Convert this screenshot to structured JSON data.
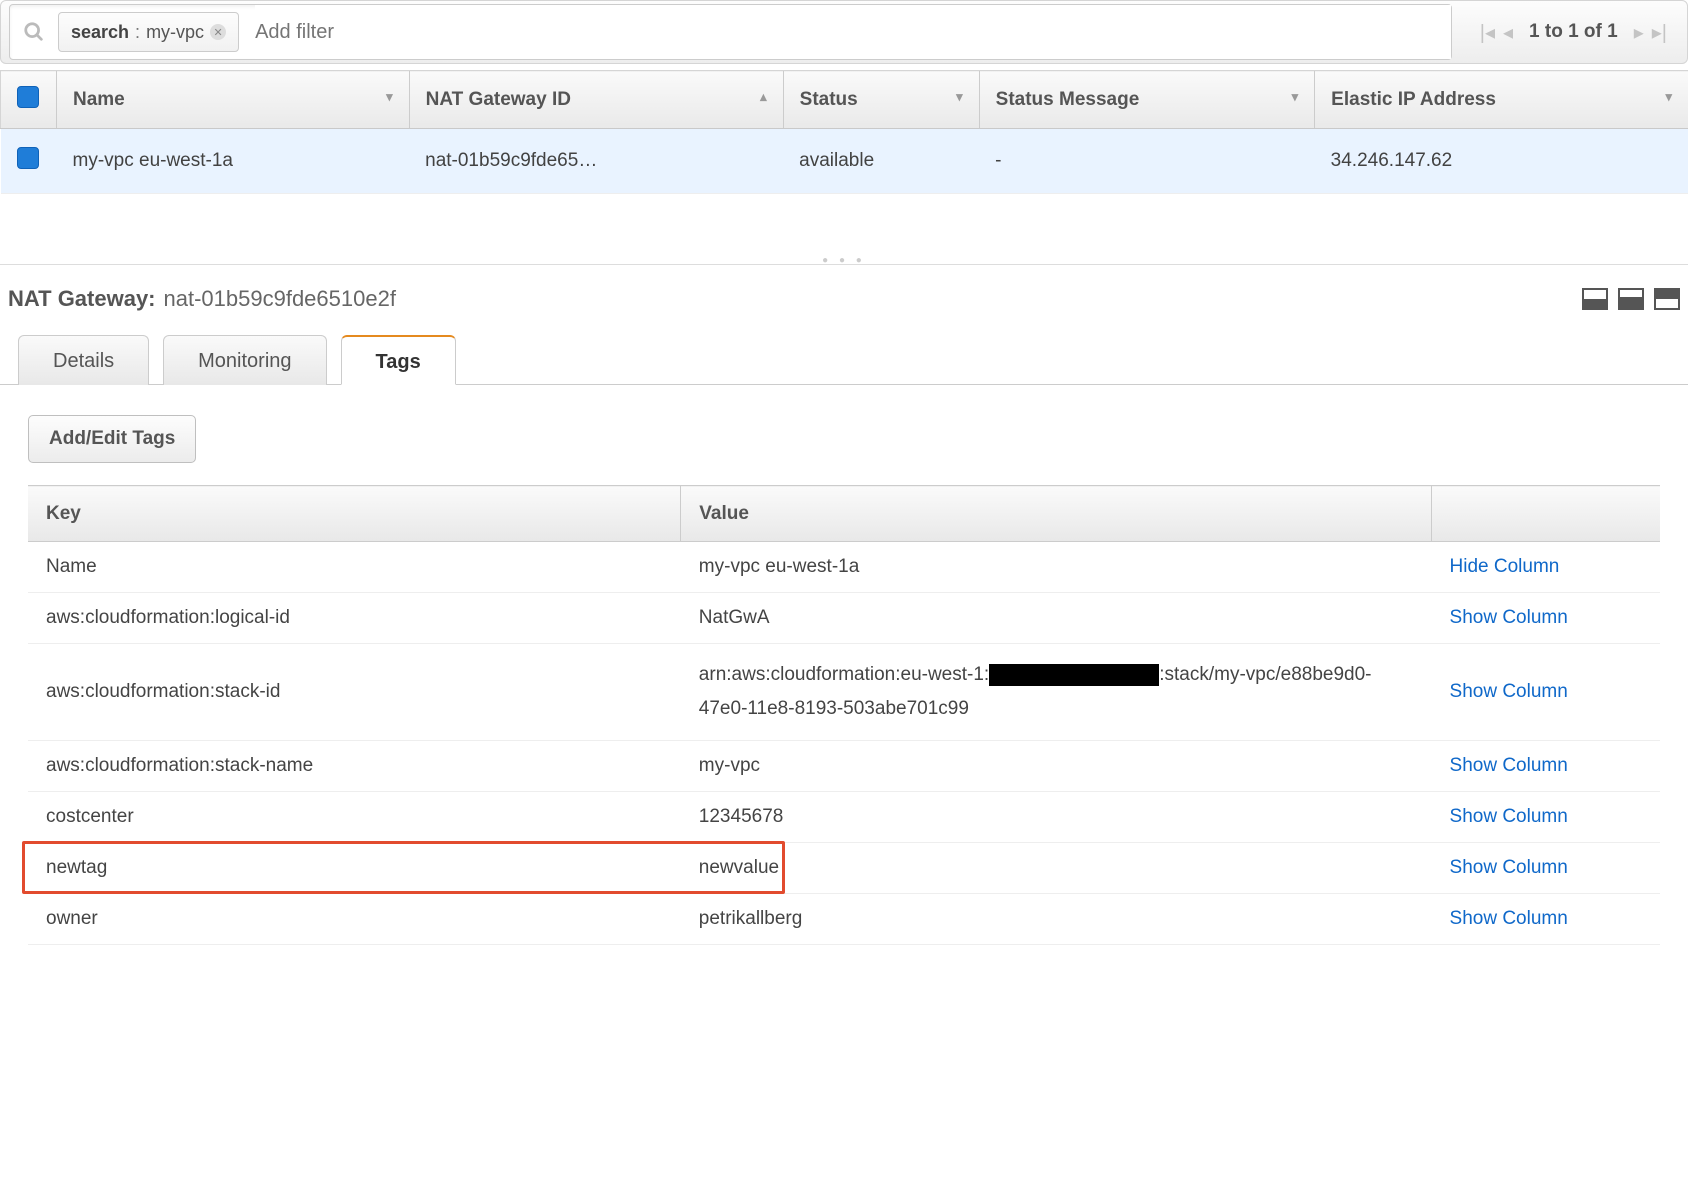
{
  "search": {
    "tag_key": "search",
    "tag_value": "my-vpc",
    "placeholder": "Add filter"
  },
  "pager": {
    "label": "1 to 1 of 1"
  },
  "columns": {
    "name": "Name",
    "id": "NAT Gateway ID",
    "status": "Status",
    "status_msg": "Status Message",
    "eip": "Elastic IP Address"
  },
  "rows": [
    {
      "name": "my-vpc eu-west-1a",
      "id": "nat-01b59c9fde65…",
      "status": "available",
      "status_msg": "-",
      "eip": "34.246.147.62"
    }
  ],
  "details": {
    "title_label": "NAT Gateway:",
    "title_id": "nat-01b59c9fde6510e2f"
  },
  "tabs": {
    "details": "Details",
    "monitoring": "Monitoring",
    "tags": "Tags"
  },
  "tags_panel": {
    "add_edit_label": "Add/Edit Tags",
    "head_key": "Key",
    "head_value": "Value",
    "hide_label": "Hide Column",
    "show_label": "Show Column",
    "rows": [
      {
        "key": "Name",
        "value": "my-vpc eu-west-1a",
        "action": "hide"
      },
      {
        "key": "aws:cloudformation:logical-id",
        "value": "NatGwA",
        "action": "show"
      },
      {
        "key": "aws:cloudformation:stack-id",
        "value_pre": "arn:aws:cloudformation:eu-west-1:",
        "value_post": ":stack/my-vpc/e88be9d0-47e0-11e8-8193-503abe701c99",
        "action": "show",
        "redacted": true
      },
      {
        "key": "aws:cloudformation:stack-name",
        "value": "my-vpc",
        "action": "show"
      },
      {
        "key": "costcenter",
        "value": "12345678",
        "action": "show"
      },
      {
        "key": "newtag",
        "value": "newvalue",
        "action": "show",
        "highlight": true
      },
      {
        "key": "owner",
        "value": "petrikallberg",
        "action": "show"
      }
    ]
  }
}
